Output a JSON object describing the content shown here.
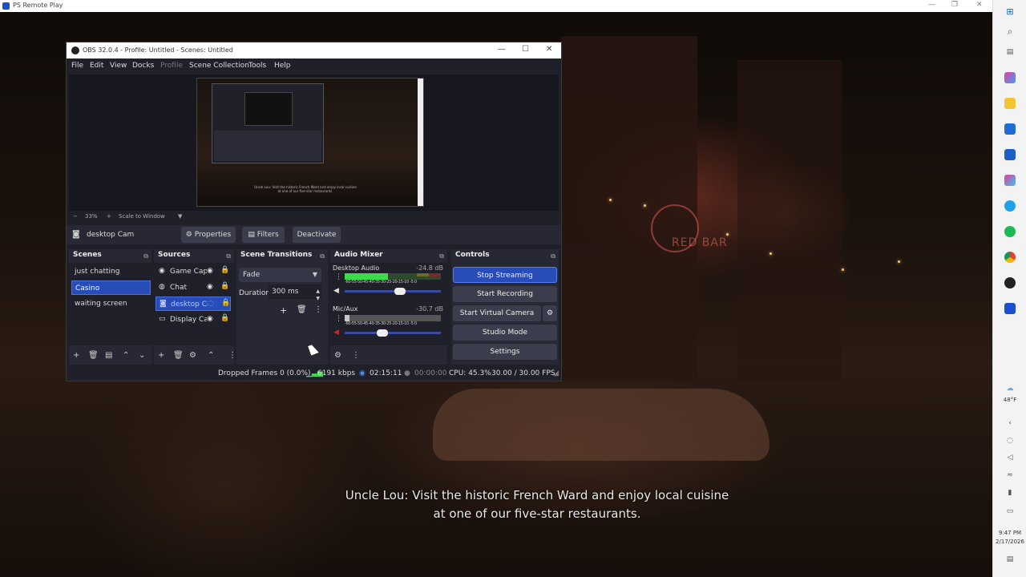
{
  "remote_play": {
    "title": "PS Remote Play"
  },
  "game": {
    "subtitle_line1": "Uncle Lou: Visit the historic French Ward and enjoy local cuisine",
    "subtitle_line2": "at one of our five-star restaurants.",
    "sign_text": "RED BAR"
  },
  "obs": {
    "title": "OBS 32.0.4 - Profile: Untitled - Scenes: Untitled",
    "menu": [
      "File",
      "Edit",
      "View",
      "Docks",
      "Profile",
      "Scene Collection",
      "Tools",
      "Help"
    ],
    "zoom": {
      "minus": "−",
      "value": "33%",
      "plus": "+",
      "mode": "Scale to Window"
    },
    "preview_subtitle": "Uncle Lou: Visit the historic French Ward and enjoy local cuisine at one of our five-star restaurants.",
    "source_bar": {
      "source_name": "desktop Cam",
      "properties": "Properties",
      "filters": "Filters",
      "deactivate": "Deactivate"
    },
    "scenes": {
      "title": "Scenes",
      "items": [
        "just chatting",
        "Casino",
        "waiting screen"
      ],
      "selected": "Casino"
    },
    "sources": {
      "title": "Sources",
      "items": [
        {
          "name": "Game Capture",
          "icon": "gamepad-icon"
        },
        {
          "name": "Chat",
          "icon": "browser-icon"
        },
        {
          "name": "desktop Cam",
          "icon": "camera-icon"
        },
        {
          "name": "Display Capture",
          "icon": "monitor-icon"
        }
      ],
      "selected": "desktop Cam"
    },
    "transitions": {
      "title": "Scene Transitions",
      "selected": "Fade",
      "duration_label": "Duration",
      "duration_value": "300 ms"
    },
    "audio": {
      "title": "Audio Mixer",
      "channels": [
        {
          "name": "Desktop Audio",
          "db": "-24.8 dB",
          "level": 0.45,
          "volume": 0.5,
          "muted": false
        },
        {
          "name": "Mic/Aux",
          "db": "-30.7 dB",
          "level": 0.05,
          "volume": 0.4,
          "muted": true
        }
      ],
      "scale": "-60-55-50-45-40-35-30-25-20-15-10 -5  0"
    },
    "controls": {
      "title": "Controls",
      "stop_streaming": "Stop Streaming",
      "start_recording": "Start Recording",
      "start_virtual_camera": "Start Virtual Camera",
      "studio_mode": "Studio Mode",
      "settings": "Settings"
    },
    "status": {
      "dropped_frames": "Dropped Frames 0 (0.0%)",
      "bitrate": "6191 kbps",
      "stream_time": "02:15:11",
      "record_time": "00:00:00",
      "cpu": "CPU: 45.3%",
      "fps": "30.00 / 30.00 FPS"
    }
  },
  "taskbar": {
    "weather": "48°F",
    "time": "9:47 PM",
    "date": "2/17/2026"
  }
}
